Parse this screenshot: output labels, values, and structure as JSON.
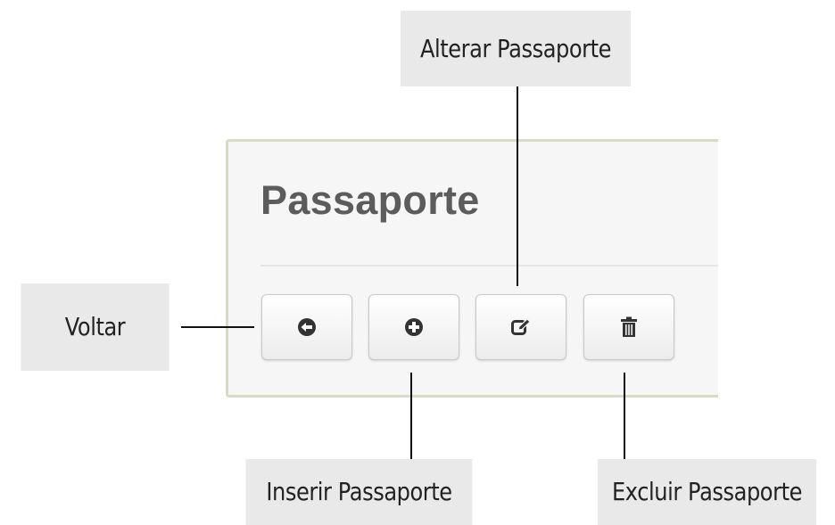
{
  "panel": {
    "title": "Passaporte"
  },
  "toolbar": {
    "buttons": [
      {
        "id": "voltar",
        "icon": "arrow-left-circle-icon"
      },
      {
        "id": "inserir",
        "icon": "plus-circle-icon"
      },
      {
        "id": "alterar",
        "icon": "edit-icon"
      },
      {
        "id": "excluir",
        "icon": "trash-icon"
      }
    ]
  },
  "callouts": {
    "alterar": "Alterar Passaporte",
    "voltar": "Voltar",
    "inserir": "Inserir Passaporte",
    "excluir": "Excluir Passaporte"
  },
  "colors": {
    "callout_bg": "#e9e9ea",
    "panel_border": "#d6dbc2",
    "icon": "#333333"
  }
}
